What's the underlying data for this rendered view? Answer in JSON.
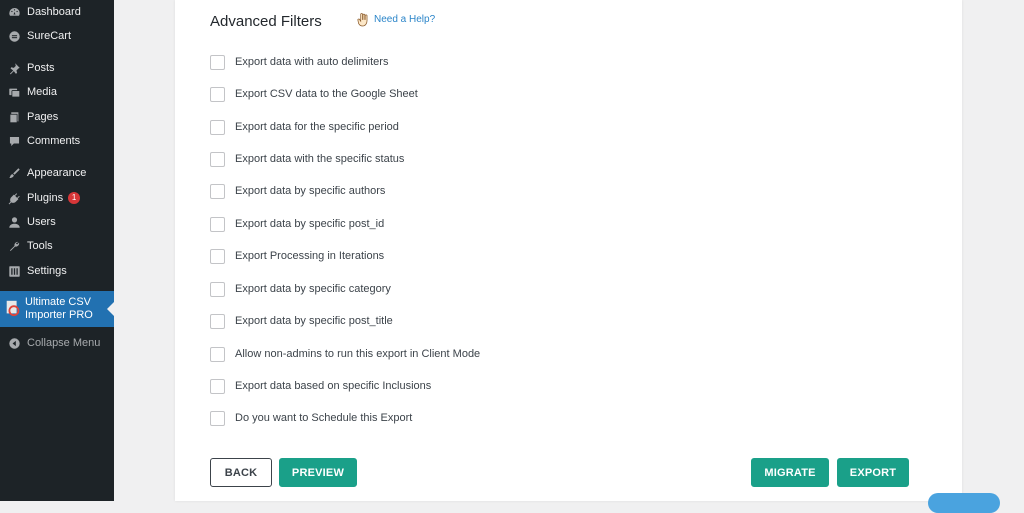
{
  "sidebar": {
    "items": [
      {
        "label": "Dashboard",
        "icon": "dashboard-icon"
      },
      {
        "label": "SureCart",
        "icon": "surecart-icon"
      },
      {
        "label": "Posts",
        "icon": "pin-icon"
      },
      {
        "label": "Media",
        "icon": "media-icon"
      },
      {
        "label": "Pages",
        "icon": "pages-icon"
      },
      {
        "label": "Comments",
        "icon": "comments-icon"
      },
      {
        "label": "Appearance",
        "icon": "brush-icon"
      },
      {
        "label": "Plugins",
        "icon": "plugin-icon",
        "badge": "1"
      },
      {
        "label": "Users",
        "icon": "user-icon"
      },
      {
        "label": "Tools",
        "icon": "wrench-icon"
      },
      {
        "label": "Settings",
        "icon": "settings-icon"
      }
    ],
    "active": {
      "line1": "Ultimate CSV",
      "line2": "Importer PRO"
    },
    "collapse": "Collapse Menu"
  },
  "main": {
    "title": "Advanced Filters",
    "help": "Need a Help?",
    "options": [
      "Export data with auto delimiters",
      "Export CSV data to the Google Sheet",
      "Export data for the specific period",
      "Export data with the specific status",
      "Export data by specific authors",
      "Export data by specific post_id",
      "Export Processing in Iterations",
      "Export data by specific category",
      "Export data by specific post_title",
      "Allow non-admins to run this export in Client Mode",
      "Export data based on specific Inclusions",
      "Do you want to Schedule this Export"
    ],
    "buttons": {
      "back": "BACK",
      "preview": "PREVIEW",
      "migrate": "MIGRATE",
      "export": "EXPORT"
    }
  },
  "colors": {
    "accent": "#1aa089",
    "sidebar_bg": "#1d2327",
    "active_bg": "#2271b1",
    "badge": "#d63638",
    "link": "#2b85c9"
  }
}
